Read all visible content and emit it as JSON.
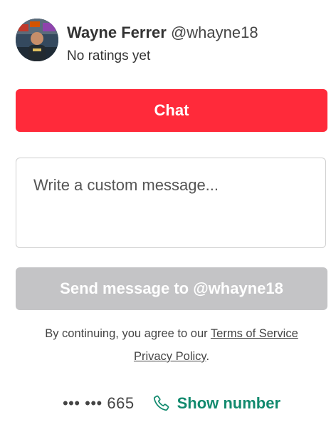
{
  "profile": {
    "name": "Wayne Ferrer",
    "handle": "@whayne18",
    "ratings": "No ratings yet"
  },
  "chat_button": {
    "label": "Chat"
  },
  "message": {
    "placeholder": "Write a custom message...",
    "value": ""
  },
  "send_button": {
    "label": "Send message to @whayne18",
    "state": "disabled"
  },
  "terms": {
    "prefix": "By continuing, you agree to our ",
    "terms_link": "Terms of Service",
    "privacy_link": "Privacy Policy",
    "suffix": "."
  },
  "phone": {
    "masked": "••• ••• 665",
    "show_label": "Show number",
    "icon": "phone-icon"
  },
  "colors": {
    "chat_button": "#ff2a3a",
    "send_button_disabled": "#c4c4c6",
    "show_number": "#128a6e"
  }
}
